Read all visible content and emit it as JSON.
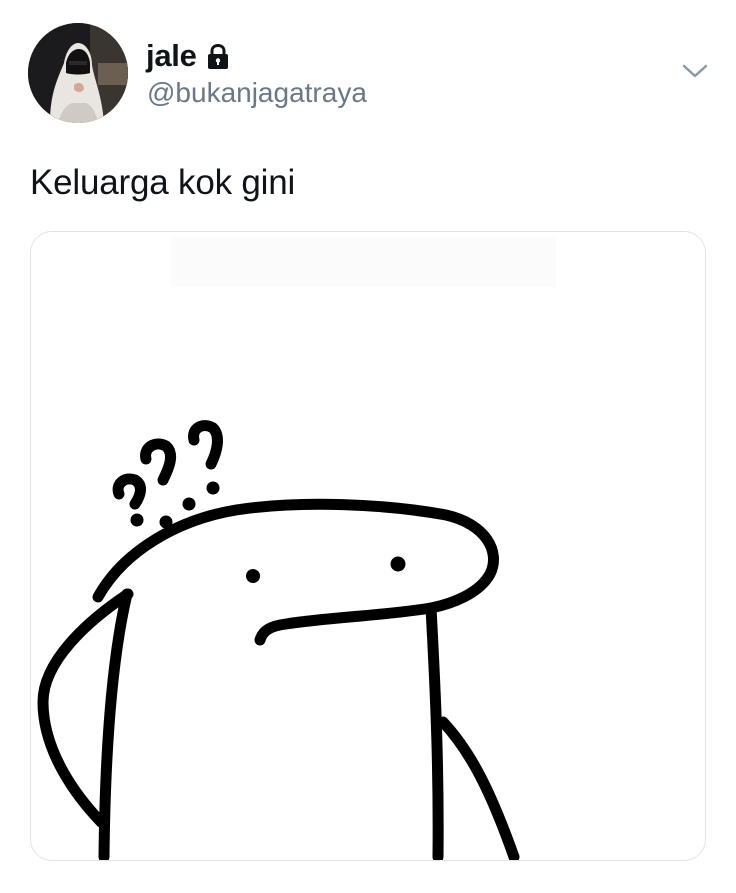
{
  "user": {
    "display_name": "jale",
    "handle": "@bukanjagatraya",
    "protected": true
  },
  "tweet": {
    "text": "Keluarga kok gini"
  },
  "icons": {
    "lock": "lock-icon",
    "menu": "chevron-down-icon"
  },
  "colors": {
    "text_primary": "#0f1419",
    "text_secondary": "#697787",
    "border": "#dfe3e7"
  }
}
